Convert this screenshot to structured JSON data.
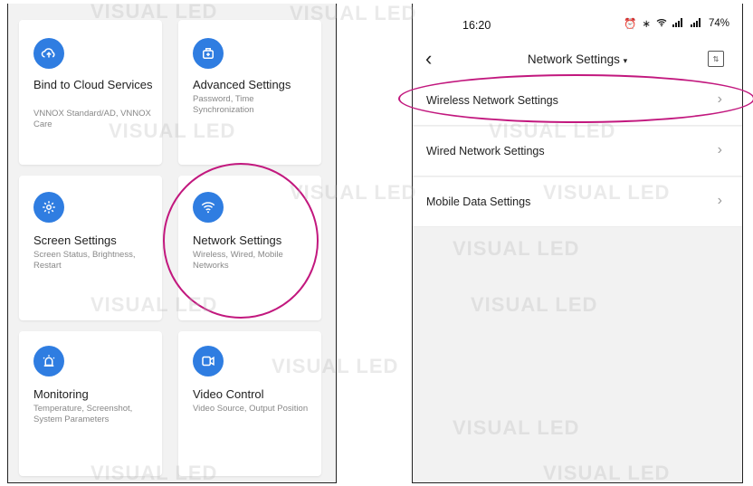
{
  "left_phone": {
    "cards": [
      {
        "title": "Bind to Cloud Services",
        "desc": "VNNOX Standard/AD, VNNOX Care",
        "icon": "cloud-upload-icon"
      },
      {
        "title": "Advanced Settings",
        "desc": "Password, Time Synchronization",
        "icon": "toolbox-icon"
      },
      {
        "title": "Screen Settings",
        "desc": "Screen Status, Brightness, Restart",
        "icon": "gear-icon"
      },
      {
        "title": "Network Settings",
        "desc": "Wireless, Wired, Mobile Networks",
        "icon": "wifi-icon"
      },
      {
        "title": "Monitoring",
        "desc": "Temperature, Screenshot, System Parameters",
        "icon": "alarm-icon"
      },
      {
        "title": "Video Control",
        "desc": "Video Source, Output Position",
        "icon": "video-icon"
      }
    ]
  },
  "right_phone": {
    "status": {
      "time": "16:20",
      "battery": "74%"
    },
    "nav": {
      "title": "Network Settings",
      "caret": "▾",
      "back": "‹"
    },
    "menu": [
      {
        "label": "Wireless Network Settings"
      },
      {
        "label": "Wired Network Settings"
      },
      {
        "label": "Mobile Data Settings"
      }
    ]
  },
  "watermark": "VISUAL LED",
  "colors": {
    "accent": "#2f7de1",
    "highlight": "#c2187e"
  }
}
